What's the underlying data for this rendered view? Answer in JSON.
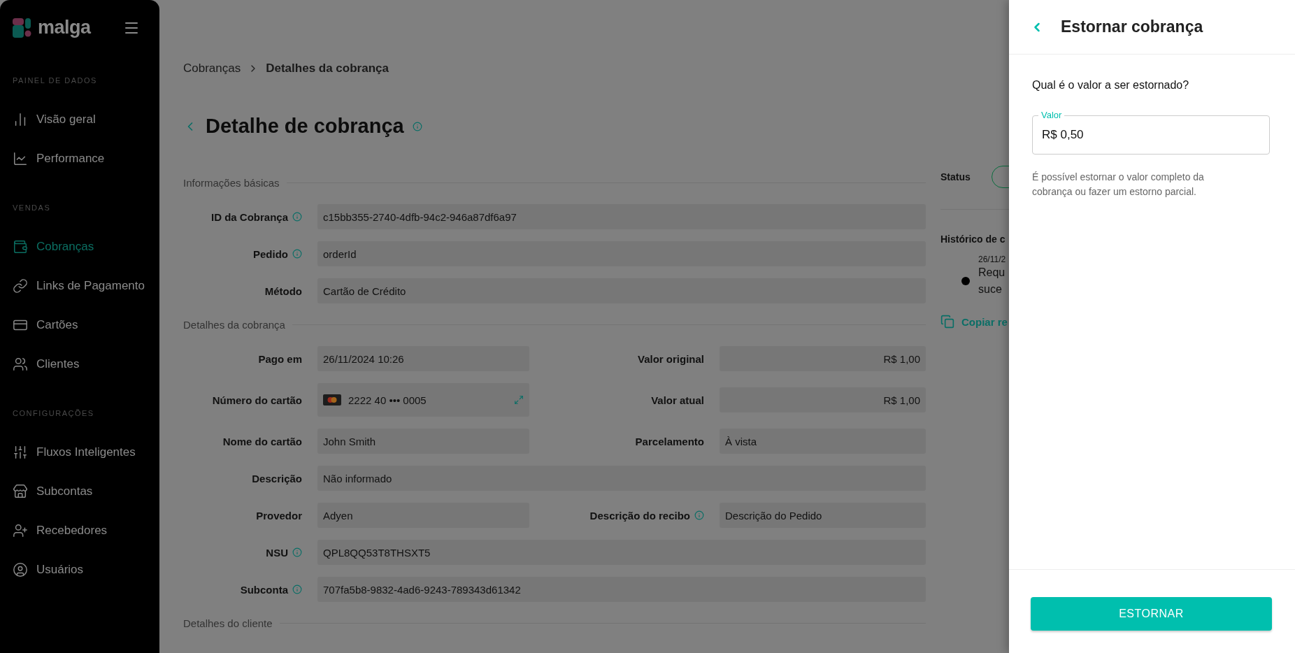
{
  "sidebar": {
    "logo": "malga",
    "sections": [
      {
        "title": "PAINEL DE DADOS",
        "items": [
          {
            "label": "Visão geral",
            "selected": false
          },
          {
            "label": "Performance",
            "selected": false
          }
        ]
      },
      {
        "title": "VENDAS",
        "items": [
          {
            "label": "Cobranças",
            "selected": true
          },
          {
            "label": "Links de Pagamento",
            "selected": false
          },
          {
            "label": "Cartões",
            "selected": false
          },
          {
            "label": "Clientes",
            "selected": false
          }
        ]
      },
      {
        "title": "CONFIGURAÇÕES",
        "items": [
          {
            "label": "Fluxos Inteligentes",
            "selected": false
          },
          {
            "label": "Subcontas",
            "selected": false
          },
          {
            "label": "Recebedores",
            "selected": false
          },
          {
            "label": "Usuários",
            "selected": false
          }
        ]
      }
    ]
  },
  "breadcrumb": [
    {
      "label": "Cobranças",
      "current": false
    },
    {
      "label": "Detalhes da cobrança",
      "current": true
    }
  ],
  "page_title": "Detalhe de cobrança",
  "sections": [
    {
      "title": "Informações básicas",
      "rows": [
        [
          {
            "label": "ID da Cobrança",
            "info": true,
            "kind": "text",
            "value": "c15bb355-2740-4dfb-94c2-946a87df6a97"
          }
        ],
        [
          {
            "label": "Pedido",
            "info": true,
            "kind": "text",
            "value": "orderId"
          }
        ],
        [
          {
            "label": "Método",
            "info": false,
            "kind": "text",
            "value": "Cartão de Crédito"
          }
        ]
      ]
    },
    {
      "title": "Detalhes da cobrança",
      "rows": [
        [
          {
            "label": "Pago em",
            "info": false,
            "kind": "text",
            "value": "26/11/2024 10:26"
          },
          {
            "label": "Valor original",
            "info": false,
            "kind": "amount",
            "value": "R$ 1,00"
          }
        ],
        [
          {
            "label": "Número do cartão",
            "info": false,
            "kind": "card",
            "value": "2222 40 ••• 0005"
          },
          {
            "label": "Valor atual",
            "info": false,
            "kind": "amount",
            "value": "R$ 1,00"
          }
        ],
        [
          {
            "label": "Nome do cartão",
            "info": false,
            "kind": "text",
            "value": "John Smith"
          },
          {
            "label": "Parcelamento",
            "info": false,
            "kind": "text",
            "value": "À vista"
          }
        ],
        [
          {
            "label": "Descrição",
            "info": false,
            "kind": "text",
            "value": "Não informado"
          }
        ],
        [
          {
            "label": "Provedor",
            "info": false,
            "kind": "text",
            "value": "Adyen"
          },
          {
            "label": "Descrição do recibo",
            "info": true,
            "kind": "text",
            "value": "Descrição do Pedido"
          }
        ],
        [
          {
            "label": "NSU",
            "info": true,
            "kind": "text",
            "value": "QPL8QQ53T8THSXT5"
          }
        ],
        [
          {
            "label": "Subconta",
            "info": true,
            "kind": "text",
            "value": "707fa5b8-9832-4ad6-9243-789343d61342"
          }
        ]
      ]
    },
    {
      "title": "Detalhes do cliente"
    }
  ],
  "side_panel": {
    "status_label": "Status",
    "history_title": "Histórico de c",
    "events": [
      {
        "date": "26/11/2",
        "lines": [
          "Requ",
          "suce"
        ]
      }
    ],
    "copy_link": "Copiar re"
  },
  "drawer": {
    "title": "Estornar cobrança",
    "question": "Qual é o valor a ser estornado?",
    "field": {
      "label": "Valor",
      "value": "R$ 0,50"
    },
    "hint": "É possível estornar o valor completo da cobrança ou fazer um estorno parcial.",
    "button": "ESTORNAR"
  }
}
